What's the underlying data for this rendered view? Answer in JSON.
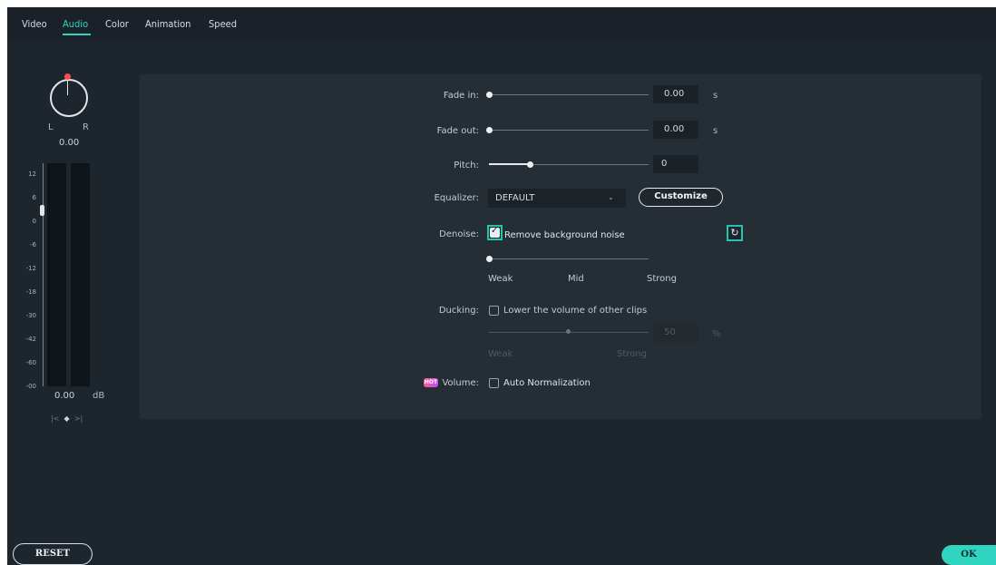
{
  "tabs": [
    {
      "label": "Video"
    },
    {
      "label": "Audio"
    },
    {
      "label": "Color"
    },
    {
      "label": "Animation"
    },
    {
      "label": "Speed"
    }
  ],
  "active_tab": "Audio",
  "meter": {
    "pan_left_label": "L",
    "pan_right_label": "R",
    "pan_value": "0.00",
    "scale": [
      "12",
      "6",
      "0",
      "-6",
      "-12",
      "-18",
      "-30",
      "-42",
      "-60",
      "-00"
    ],
    "db_value": "0.00",
    "db_unit": "dB",
    "nav_icons": [
      "prev-keyframe-icon",
      "add-keyframe-icon",
      "next-keyframe-icon"
    ]
  },
  "fade_in": {
    "label": "Fade in:",
    "value": "0.00",
    "unit": "s",
    "level": 0
  },
  "fade_out": {
    "label": "Fade out:",
    "value": "0.00",
    "unit": "s",
    "level": 0
  },
  "pitch": {
    "label": "Pitch:",
    "value": "0",
    "level": 0.5
  },
  "equalizer": {
    "label": "Equalizer:",
    "selected": "DEFAULT",
    "customize_label": "Customize"
  },
  "denoise": {
    "label": "Denoise:",
    "checkbox_label": "Remove background noise",
    "checked": true,
    "level": 0,
    "scale": {
      "weak": "Weak",
      "mid": "Mid",
      "strong": "Strong"
    }
  },
  "ducking": {
    "label": "Ducking:",
    "checkbox_label": "Lower the volume of other clips",
    "checked": false,
    "value": "50",
    "unit": "%",
    "level": 0.5,
    "scale": {
      "weak": "Weak",
      "strong": "Strong"
    }
  },
  "volume": {
    "badge": "HOT",
    "label": "Volume:",
    "checkbox_label": "Auto Normalization",
    "checked": false
  },
  "footer": {
    "reset_label": "RESET",
    "ok_label": "OK"
  },
  "colors": {
    "accent": "#2fd5c1",
    "background": "#1e262d",
    "panel": "#252e35"
  }
}
